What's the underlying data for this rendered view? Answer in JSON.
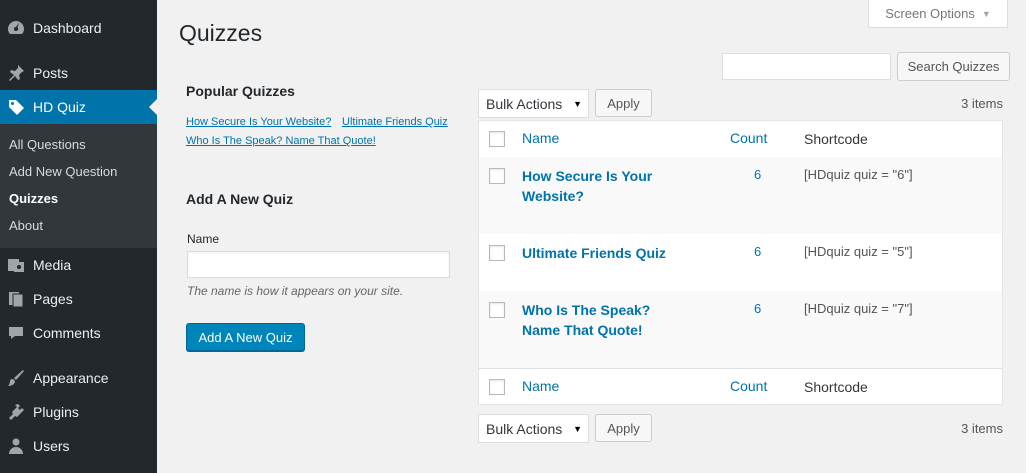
{
  "sidebar": {
    "items": [
      {
        "label": "Dashboard",
        "icon": "dashboard-icon"
      },
      {
        "label": "Posts",
        "icon": "pin-icon"
      },
      {
        "label": "HD Quiz",
        "icon": "tag-icon"
      },
      {
        "label": "Media",
        "icon": "media-icon"
      },
      {
        "label": "Pages",
        "icon": "pages-icon"
      },
      {
        "label": "Comments",
        "icon": "comment-icon"
      },
      {
        "label": "Appearance",
        "icon": "brush-icon"
      },
      {
        "label": "Plugins",
        "icon": "plug-icon"
      },
      {
        "label": "Users",
        "icon": "user-icon"
      }
    ],
    "submenu": [
      "All Questions",
      "Add New Question",
      "Quizzes",
      "About"
    ],
    "active_color": "#0073aa"
  },
  "header": {
    "title": "Quizzes",
    "screen_options": "Screen Options"
  },
  "popular": {
    "title": "Popular Quizzes",
    "links": [
      "How Secure Is Your Website?",
      "Ultimate Friends Quiz",
      "Who Is The Speak? Name That Quote!"
    ]
  },
  "add_form": {
    "title": "Add A New Quiz",
    "name_label": "Name",
    "name_value": "",
    "description": "The name is how it appears on your site.",
    "button": "Add A New Quiz"
  },
  "search": {
    "value": "",
    "button": "Search Quizzes"
  },
  "bulk": {
    "select": "Bulk Actions",
    "apply": "Apply",
    "count": "3 items"
  },
  "table": {
    "columns": {
      "name": "Name",
      "count": "Count",
      "shortcode": "Shortcode"
    },
    "rows": [
      {
        "name": "How Secure Is Your Website?",
        "count": "6",
        "shortcode": "[HDquiz quiz = \"6\"]"
      },
      {
        "name": "Ultimate Friends Quiz",
        "count": "6",
        "shortcode": "[HDquiz quiz = \"5\"]"
      },
      {
        "name": "Who Is The Speak? Name That Quote!",
        "count": "6",
        "shortcode": "[HDquiz quiz = \"7\"]"
      }
    ]
  }
}
